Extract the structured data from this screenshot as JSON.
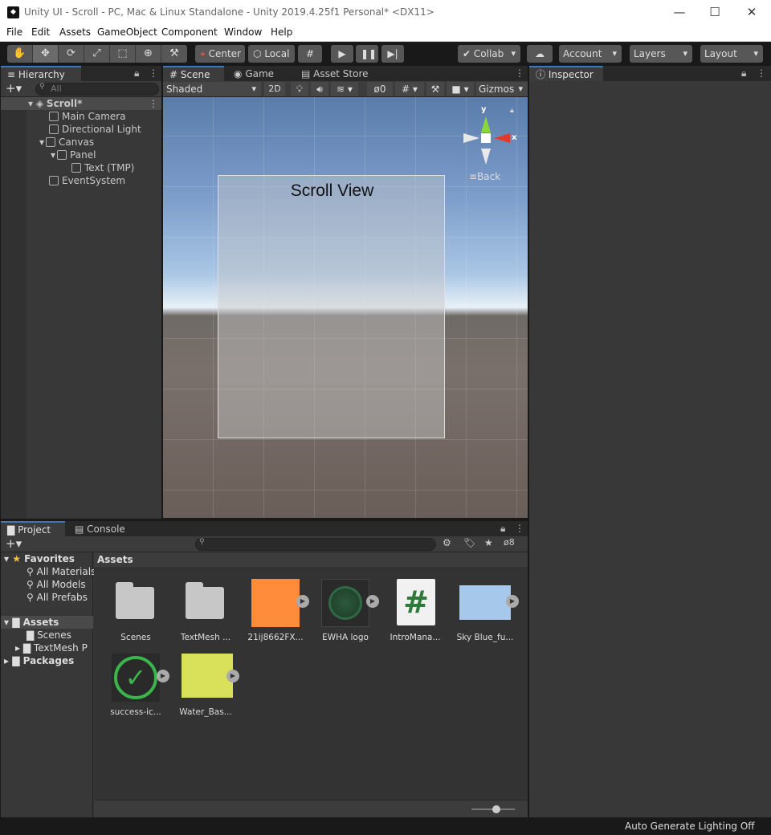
{
  "window": {
    "title": "Unity UI - Scroll - PC, Mac & Linux Standalone - Unity 2019.4.25f1 Personal* <DX11>",
    "minimize": "—",
    "maximize": "☐",
    "close": "✕"
  },
  "menu": [
    "File",
    "Edit",
    "Assets",
    "GameObject",
    "Component",
    "Window",
    "Help"
  ],
  "toolbar": {
    "tools": [
      {
        "icon": "hand-icon",
        "glyph": "✋"
      },
      {
        "icon": "move-icon",
        "glyph": "✥"
      },
      {
        "icon": "rotate-icon",
        "glyph": "⟳"
      },
      {
        "icon": "scale-icon",
        "glyph": "⤢"
      },
      {
        "icon": "rect-icon",
        "glyph": "⬚"
      },
      {
        "icon": "transform-icon",
        "glyph": "⊕"
      },
      {
        "icon": "custom-tool-icon",
        "glyph": "⚒"
      }
    ],
    "pivot": "Center",
    "space": "Local",
    "collab": "Collab",
    "account": "Account",
    "layers": "Layers",
    "layout": "Layout"
  },
  "hierarchy": {
    "tab": "Hierarchy",
    "search_placeholder": "All",
    "scene": "Scroll*",
    "items": [
      "Main Camera",
      "Directional Light",
      "Canvas",
      "Panel",
      "Text (TMP)",
      "EventSystem"
    ]
  },
  "scene_tabs": [
    "Scene",
    "Game",
    "Asset Store"
  ],
  "scene_toolbar": {
    "shading": "Shaded",
    "mode2d": "2D",
    "hidden_count": "0",
    "gizmos": "Gizmos"
  },
  "scene": {
    "panel_text": "Scroll View",
    "back_label": "Back",
    "axis_y": "y",
    "axis_x": "x"
  },
  "inspector": {
    "tab": "Inspector"
  },
  "project": {
    "tabs": [
      "Project",
      "Console"
    ],
    "hidden_count": "8",
    "tree": {
      "favorites": "Favorites",
      "fav_items": [
        "All Materials",
        "All Models",
        "All Prefabs"
      ],
      "assets": "Assets",
      "asset_children": [
        "Scenes",
        "TextMesh P"
      ],
      "packages": "Packages"
    },
    "breadcrumb": "Assets",
    "assets": [
      {
        "name": "Scenes",
        "kind": "folder"
      },
      {
        "name": "TextMesh ...",
        "kind": "folder"
      },
      {
        "name": "21ij8662FX...",
        "kind": "image",
        "color": "#ff8c3a"
      },
      {
        "name": "EWHA logo",
        "kind": "logo"
      },
      {
        "name": "IntroMana...",
        "kind": "script"
      },
      {
        "name": "Sky Blue_fu...",
        "kind": "image",
        "color": "#a6c8ea"
      },
      {
        "name": "success-ic...",
        "kind": "check"
      },
      {
        "name": "Water_Bas...",
        "kind": "image",
        "color": "#d9e05a"
      }
    ]
  },
  "status": "Auto Generate Lighting Off"
}
